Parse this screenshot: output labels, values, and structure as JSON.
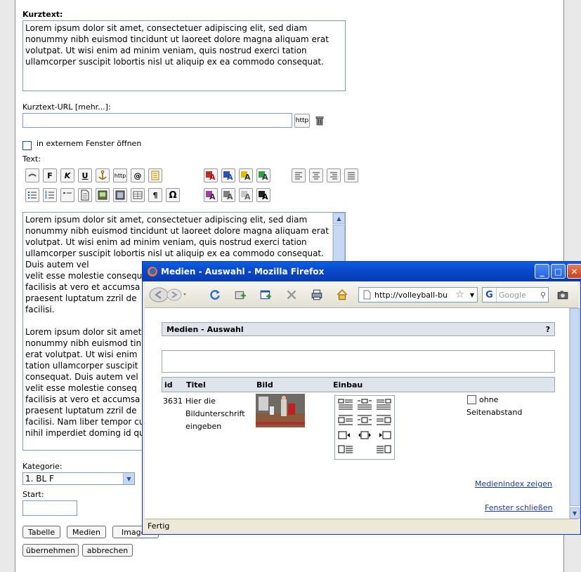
{
  "form": {
    "kurztext_label": "Kurztext:",
    "kurztext_value": "Lorem ipsum dolor sit amet, consectetuer adipiscing elit, sed diam nonummy nibh euismod tincidunt ut laoreet dolore magna aliquam erat volutpat. Ut wisi enim ad minim veniam, quis nostrud exerci tation ullamcorper suscipit lobortis nisl ut aliquip ex ea commodo consequat.",
    "url_label": "Kurztext-URL [mehr...]:",
    "url_value": "",
    "http_button": "http",
    "extern_label": "in externem Fenster öffnen",
    "text_label": "Text:",
    "text_value": "Lorem ipsum dolor sit amet, consectetuer adipiscing elit, sed diam nonummy nibh euismod tincidunt ut laoreet dolore magna aliquam erat volutpat. Ut wisi enim ad minim veniam, quis nostrud exerci tation ullamcorper suscipit lobortis nisl ut aliquip ex ea commodo consequat. Duis autem vel\nvelit esse molestie consequ\nfacilisis at vero et accumsa\npraesent luptatum zzril de\nfacilisi.\n\nLorem ipsum dolor sit amet\nnonummy nibh euismod tin\nerat volutpat. Ut wisi enim\ntation ullamcorper suscipit\nconsequat. Duis autem vel\nvelit esse molestie conseq\nfacilisis at vero et accumsa\npraesent luptatum zzril de\nfacilisi. Nam liber tempor cu\nnihil imperdiet doming id qu",
    "kategorie_label": "Kategorie:",
    "kategorie_value": "1. BL F",
    "start_label": "Start:",
    "start_value": "",
    "buttons": {
      "tabelle": "Tabelle",
      "medien": "Medien",
      "images": "Images",
      "uebernehmen": "übernehmen",
      "abbrechen": "abbrechen"
    },
    "toolbar": {
      "bold": "F",
      "italic": "K",
      "underline": "U",
      "http": "http",
      "at": "@",
      "pilcrow": "¶",
      "omega": "Ω"
    }
  },
  "popup": {
    "title": "Medien - Auswahl - Mozilla Firefox",
    "url": "http://volleyball-bu",
    "search_placeholder": "Google",
    "status": "Fertig",
    "header_title": "Medien - Auswahl",
    "header_help": "?",
    "columns": [
      "id",
      "Titel",
      "Bild",
      "Einbau"
    ],
    "row": {
      "id": "3631",
      "titel_line1": "Hier die",
      "titel_line2": "Bildunterschrift",
      "titel_line3": "eingeben",
      "ohne_line1": "ohne",
      "ohne_line2": "Seitenabstand"
    },
    "link_index": "Medienindex zeigen",
    "link_close": "Fenster schließen"
  },
  "colors": {
    "xp_blue": "#0a46c8",
    "link": "#1a3c99",
    "field_border": "#7f9db9"
  }
}
